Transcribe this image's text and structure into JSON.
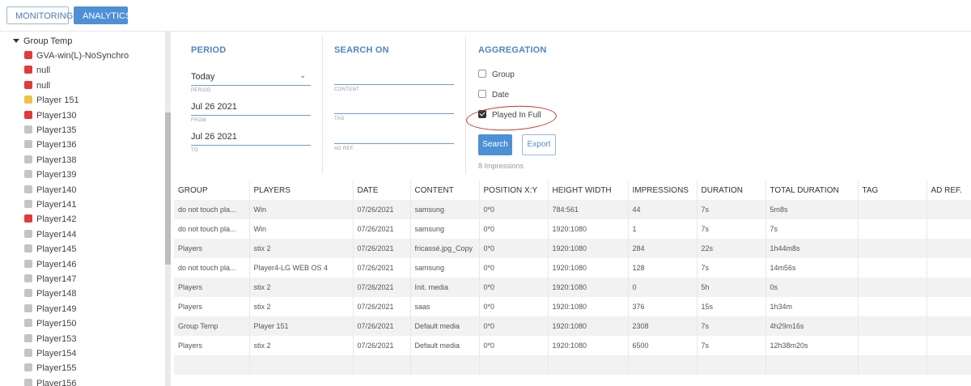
{
  "tabs": {
    "monitoring": "MONITORING",
    "analytics": "ANALYTICS"
  },
  "sidebar": {
    "group": "Group Temp",
    "items": [
      {
        "label": "GVA-win(L)-NoSynchro",
        "status_color": "#e03a3a"
      },
      {
        "label": "null",
        "status_color": "#e03a3a"
      },
      {
        "label": "null",
        "status_color": "#e03a3a"
      },
      {
        "label": "Player 151",
        "status_color": "#f0c24b"
      },
      {
        "label": "Player130",
        "status_color": "#e03a3a"
      },
      {
        "label": "Player135",
        "status_color": "#c4c4c4"
      },
      {
        "label": "Player136",
        "status_color": "#c4c4c4"
      },
      {
        "label": "Player138",
        "status_color": "#c4c4c4"
      },
      {
        "label": "Player139",
        "status_color": "#c4c4c4"
      },
      {
        "label": "Player140",
        "status_color": "#c4c4c4"
      },
      {
        "label": "Player141",
        "status_color": "#c4c4c4"
      },
      {
        "label": "Player142",
        "status_color": "#e03a3a"
      },
      {
        "label": "Player144",
        "status_color": "#c4c4c4"
      },
      {
        "label": "Player145",
        "status_color": "#c4c4c4"
      },
      {
        "label": "Player146",
        "status_color": "#c4c4c4"
      },
      {
        "label": "Player147",
        "status_color": "#c4c4c4"
      },
      {
        "label": "Player148",
        "status_color": "#c4c4c4"
      },
      {
        "label": "Player149",
        "status_color": "#c4c4c4"
      },
      {
        "label": "Player150",
        "status_color": "#c4c4c4"
      },
      {
        "label": "Player153",
        "status_color": "#c4c4c4"
      },
      {
        "label": "Player154",
        "status_color": "#c4c4c4"
      },
      {
        "label": "Player155",
        "status_color": "#c4c4c4"
      },
      {
        "label": "Player156",
        "status_color": "#c4c4c4"
      }
    ]
  },
  "period": {
    "title": "PERIOD",
    "period_value": "Today",
    "period_label": "PERIOD",
    "from_value": "Jul 26 2021",
    "from_label": "FROM",
    "to_value": "Jul 26 2021",
    "to_label": "TO"
  },
  "search_on": {
    "title": "SEARCH ON",
    "content_value": "",
    "content_label": "CONTENT",
    "tag_value": "",
    "tag_label": "TAG",
    "adref_value": "",
    "adref_label": "AD REF."
  },
  "aggregation": {
    "title": "AGGREGATION",
    "group_label": "Group",
    "group_checked": false,
    "date_label": "Date",
    "date_checked": false,
    "played_label": "Played In Full",
    "played_checked": true,
    "search_button": "Search",
    "export_button": "Export",
    "impressions_text": "8 Impressions"
  },
  "table": {
    "columns": [
      "GROUP",
      "PLAYERS",
      "DATE",
      "CONTENT",
      "POSITION X:Y",
      "HEIGHT WIDTH",
      "IMPRESSIONS",
      "DURATION",
      "TOTAL DURATION",
      "TAG",
      "AD REF."
    ],
    "rows": [
      [
        "do not touch pla...",
        "Win",
        "07/26/2021",
        "samsung",
        "0*0",
        "784:561",
        "44",
        "7s",
        "5m8s",
        "",
        ""
      ],
      [
        "do not touch pla...",
        "Win",
        "07/26/2021",
        "samsung",
        "0*0",
        "1920:1080",
        "1",
        "7s",
        "7s",
        "",
        ""
      ],
      [
        "Players",
        "stix 2",
        "07/26/2021",
        "fricassé.jpg_Copy",
        "0*0",
        "1920:1080",
        "284",
        "22s",
        "1h44m8s",
        "",
        ""
      ],
      [
        "do not touch pla...",
        "Player4-LG WEB OS 4",
        "07/26/2021",
        "samsung",
        "0*0",
        "1920:1080",
        "128",
        "7s",
        "14m56s",
        "",
        ""
      ],
      [
        "Players",
        "stix 2",
        "07/26/2021",
        "Init. media",
        "0*0",
        "1920:1080",
        "0",
        "5h",
        "0s",
        "",
        ""
      ],
      [
        "Players",
        "stix 2",
        "07/26/2021",
        "saas",
        "0*0",
        "1920:1080",
        "376",
        "15s",
        "1h34m",
        "",
        ""
      ],
      [
        "Group Temp",
        "Player 151",
        "07/26/2021",
        "Default media",
        "0*0",
        "1920:1080",
        "2308",
        "7s",
        "4h29m16s",
        "",
        ""
      ],
      [
        "Players",
        "stix 2",
        "07/26/2021",
        "Default media",
        "0*0",
        "1920:1080",
        "6500",
        "7s",
        "12h38m20s",
        "",
        ""
      ],
      [
        "",
        "",
        "",
        "",
        "",
        "",
        "",
        "",
        "",
        "",
        ""
      ]
    ]
  }
}
